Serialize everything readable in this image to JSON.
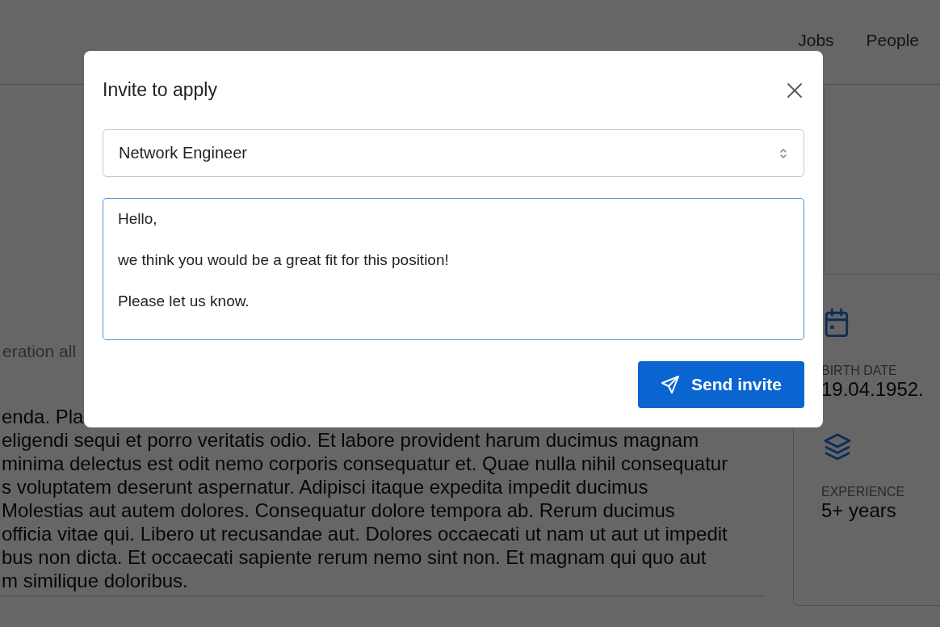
{
  "nav": [
    {
      "label": "Jobs"
    },
    {
      "label": "People"
    }
  ],
  "content": {
    "subtitle": "eration all",
    "paragraph_lines": [
      "enda. Pla",
      "eligendi sequi et porro veritatis odio. Et labore provident harum ducimus magnam",
      "minima delectus est odit nemo corporis consequatur et. Quae nulla nihil consequatur",
      "s voluptatem deserunt aspernatur. Adipisci itaque expedita impedit ducimus",
      "Molestias aut autem dolores. Consequatur dolore tempora ab. Rerum ducimus",
      "officia vitae qui. Libero ut recusandae aut. Dolores occaecati ut nam ut aut ut impedit",
      "bus non dicta. Et occaecati sapiente rerum nemo sint non. Et magnam qui quo aut",
      "m similique doloribus."
    ]
  },
  "details": [
    {
      "kind": "calendar",
      "label": "BIRTH DATE",
      "value": "19.04.1952."
    },
    {
      "kind": "layers",
      "label": "EXPERIENCE",
      "value": "5+ years"
    }
  ],
  "modal": {
    "title": "Invite to apply",
    "position_select": {
      "value": "Network Engineer"
    },
    "message": {
      "value": "Hello,\n\nwe think you would be a great fit for this position!\n\nPlease let us know.",
      "focused": true
    },
    "send_button": {
      "label": "Send invite"
    }
  }
}
